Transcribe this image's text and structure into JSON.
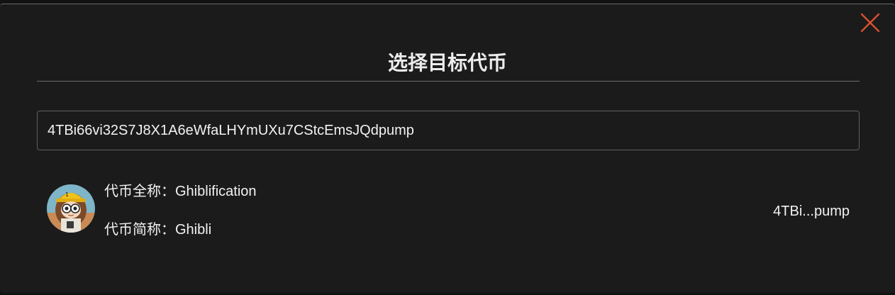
{
  "dialog": {
    "title": "选择目标代币",
    "close_icon": "close-icon",
    "accent_color": "#d9502f"
  },
  "search": {
    "value": "4TBi66vi32S7J8X1A6eWfaLHYmUXu7CStcEmsJQdpump"
  },
  "results": [
    {
      "full_name_label": "代币全称：",
      "full_name": "Ghiblification",
      "short_name_label": "代币简称：",
      "short_name": "Ghibli",
      "address_short": "4TBi...pump",
      "avatar_icon": "token-avatar"
    }
  ]
}
